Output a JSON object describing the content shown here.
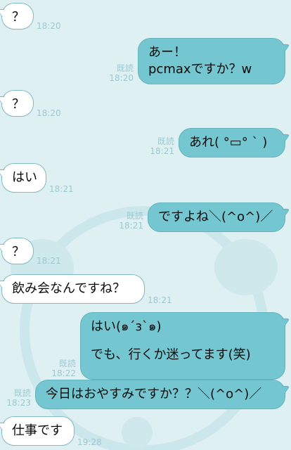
{
  "chat": {
    "read_label": "既読",
    "messages": [
      {
        "side": "in",
        "lines": [
          "？"
        ],
        "time": "18:20"
      },
      {
        "side": "out",
        "lines": [
          "あー！",
          "pcmaxですか？w"
        ],
        "time": "18:20",
        "read": "既読"
      },
      {
        "side": "in",
        "lines": [
          "？"
        ],
        "time": "18:20"
      },
      {
        "side": "out",
        "lines": [
          "あれ( °▭° ` )"
        ],
        "time": "18:21",
        "read": "既読"
      },
      {
        "side": "in",
        "lines": [
          "はい"
        ],
        "time": "18:21"
      },
      {
        "side": "out",
        "lines": [
          "ですよね＼(^o^)／"
        ],
        "time": "18:21",
        "read": "既読"
      },
      {
        "side": "in",
        "lines": [
          "？"
        ],
        "time": "18:21"
      },
      {
        "side": "in",
        "lines": [
          "飲み会なんですね？"
        ],
        "time": "18:21"
      },
      {
        "side": "out",
        "lines": [
          "はい(๑´з`๑)",
          "",
          "でも、行くか迷ってます(笑)"
        ],
        "time": "18:22",
        "read": "既読"
      },
      {
        "side": "out",
        "lines": [
          "今日はおやすみですか？？＼(^o^)／"
        ],
        "time": "18:23",
        "read": "既読"
      },
      {
        "side": "in",
        "lines": [
          "仕事です"
        ],
        "time": "19:28"
      }
    ]
  },
  "colors": {
    "background": "#dff0f3",
    "outgoing_bubble": "#74c7d1",
    "incoming_bubble": "#ffffff",
    "meta_text": "#9cc9d0"
  }
}
